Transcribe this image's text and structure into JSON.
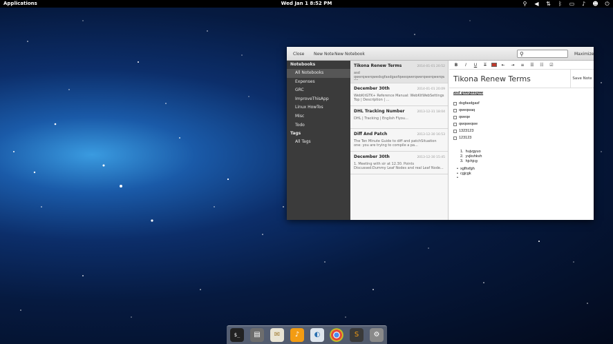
{
  "panel": {
    "applications": "Applications",
    "clock": "Wed Jan  1  8:52 PM",
    "tray_icons": [
      "search-icon",
      "volume-icon",
      "network-icon",
      "bluetooth-icon",
      "battery-icon",
      "notification-icon",
      "user-icon",
      "power-icon"
    ]
  },
  "toolbar": {
    "close": "Close",
    "new_note": "New Note",
    "new_notebook": "New Notebook",
    "search_placeholder": "",
    "maximize": "Maximize"
  },
  "sidebar": {
    "notebooks_header": "Notebooks",
    "notebooks": [
      "All Notebooks",
      "Expenses",
      "GRC",
      "ImproveThisApp",
      "Linux HowTos",
      "Misc",
      "Todo"
    ],
    "tags_header": "Tags",
    "tags": [
      "All Tags"
    ]
  },
  "notes": [
    {
      "title": "Tikona Renew Terms",
      "date": "2014-01-01 20:52",
      "snippet": "asd qwerqwerqwedsgfasdgasfqweqwerqwerqwerqwerqwee1 23"
    },
    {
      "title": "December 30th",
      "date": "2014-01-01 20:09",
      "snippet": "WebKitGTK+ Reference Manual: WebKitWebSettings  Top | Description | ..."
    },
    {
      "title": "DHL Tracking Number",
      "date": "2013-12-31 18:04",
      "snippet": "DHL | Tracking | English  Flyou..."
    },
    {
      "title": "Diff And Patch",
      "date": "2013-12-30 16:53",
      "snippet": "The Ten Minute Guide to diff and patchSituation one: you are trying to compile a pa..."
    },
    {
      "title": "December 30th",
      "date": "2013-12-30 15:45",
      "snippet": "1. Meeting with sir at 12.30.  Points Discussed:Dummy Leaf Nodes and real Leaf Node..."
    }
  ],
  "editor": {
    "format_buttons": [
      "B",
      "I",
      "U",
      "T"
    ],
    "title": "Tikona Renew Terms",
    "save_note": "Save Note",
    "heading": "asd qweqweqwe",
    "checklist": [
      "dsgfasdgasf",
      "qweqwaq",
      "qweqe",
      "qwqweqwe",
      "1323123",
      "123123"
    ],
    "ordered": [
      "hujvgyuo",
      "yvjkvhkvh",
      "hjchjcg"
    ],
    "bullets": [
      "xgfhxfgh",
      "cgjcgk",
      ""
    ]
  },
  "dock": [
    "terminal-icon",
    "files-icon",
    "mail-icon",
    "music-icon",
    "switchboard-icon",
    "chrome-icon",
    "sublime-icon",
    "settings-icon"
  ]
}
